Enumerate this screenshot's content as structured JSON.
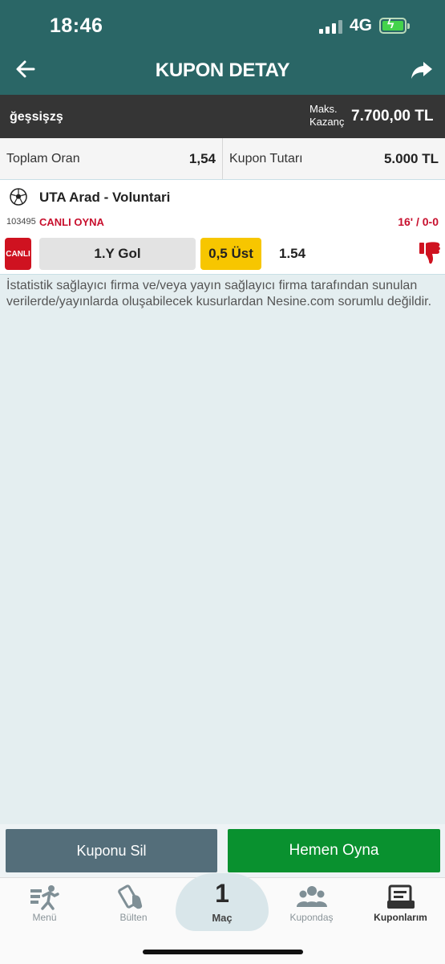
{
  "status_bar": {
    "time": "18:46",
    "network": "4G"
  },
  "header": {
    "title": "KUPON DETAY",
    "back_icon": "arrow-left-icon",
    "share_icon": "share-icon"
  },
  "summary": {
    "owner": "ğeşsişzş",
    "max_label": "Maks. Kazanç",
    "max_value": "7.700,00 TL"
  },
  "totals": {
    "total_odds_label": "Toplam Oran",
    "total_odds_value": "1,54",
    "coupon_amount_label": "Kupon Tutarı",
    "coupon_amount_value": "5.000 TL"
  },
  "match": {
    "name": "UTA Arad - Voluntari",
    "code": "103495",
    "live_link": "CANLI OYNA",
    "score": "16' / 0-0",
    "badge": "CANLI",
    "market": "1.Y Gol",
    "pick": "0,5 Üst",
    "odd": "1.54",
    "sport_icon": "soccer-ball-icon",
    "result_icon": "thumbs-down-icon"
  },
  "disclaimer": "İstatistik sağlayıcı firma ve/veya yayın sağlayıcı firma tarafından sunulan verilerde/yayınlarda oluşabilecek kusurlardan Nesine.com sorumlu değildir.",
  "actions": {
    "delete_label": "Kuponu Sil",
    "play_label": "Hemen Oyna"
  },
  "tabs": [
    {
      "label": "Menü",
      "icon": "menu-runner-icon"
    },
    {
      "label": "Bülten",
      "icon": "bulletin-icon"
    },
    {
      "label": "Maç",
      "count": "1"
    },
    {
      "label": "Kupondaş",
      "icon": "people-icon"
    },
    {
      "label": "Kuponlarım",
      "icon": "coupons-icon",
      "active": true
    }
  ],
  "colors": {
    "header": "#2a6666",
    "dark_bar": "#353535",
    "live_red": "#cf1220",
    "pick_yellow": "#f7c600",
    "delete_btn": "#546e7a",
    "play_btn": "#09912f"
  }
}
